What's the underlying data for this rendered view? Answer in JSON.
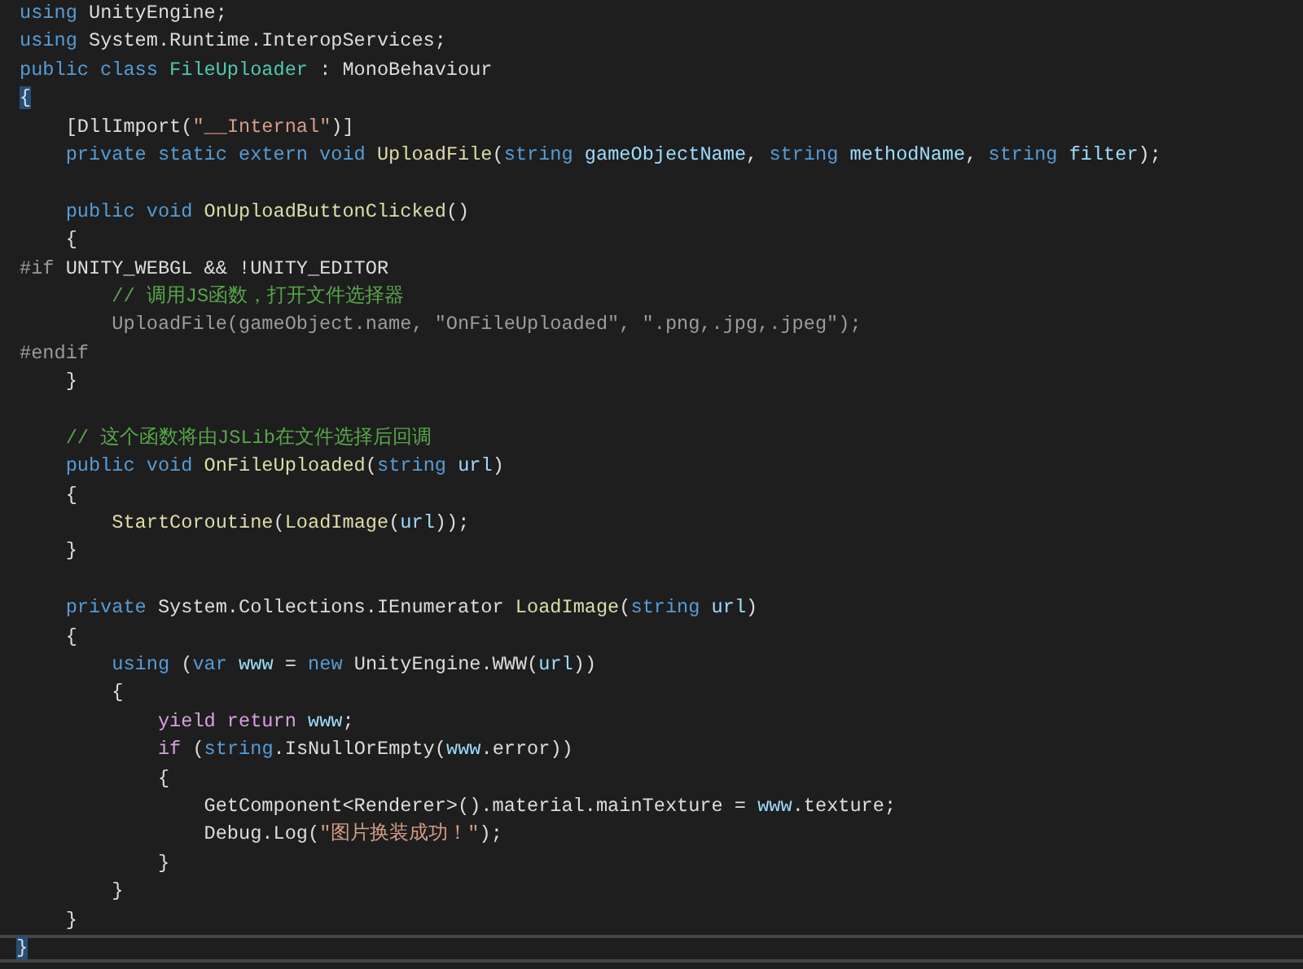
{
  "editor": {
    "lines": [
      {
        "kind": "code",
        "tokens": [
          {
            "text": "using",
            "kind": "keyword"
          },
          {
            "text": " UnityEngine;",
            "kind": "plain"
          }
        ]
      },
      {
        "kind": "code",
        "tokens": [
          {
            "text": "using",
            "kind": "keyword"
          },
          {
            "text": " System.Runtime.InteropServices;",
            "kind": "plain"
          }
        ]
      },
      {
        "kind": "code",
        "tokens": [
          {
            "text": "public class ",
            "kind": "keyword"
          },
          {
            "text": "FileUploader",
            "kind": "type"
          },
          {
            "text": " : MonoBehaviour",
            "kind": "plain"
          }
        ]
      },
      {
        "kind": "code",
        "tokens": [
          {
            "text": "{",
            "kind": "plain",
            "highlighted": true
          }
        ]
      },
      {
        "kind": "code",
        "tokens": [
          {
            "text": "    [DllImport(",
            "kind": "plain"
          },
          {
            "text": "\"__Internal\"",
            "kind": "string"
          },
          {
            "text": ")]",
            "kind": "plain"
          }
        ]
      },
      {
        "kind": "code",
        "tokens": [
          {
            "text": "    private static extern void ",
            "kind": "keyword"
          },
          {
            "text": "UploadFile",
            "kind": "method"
          },
          {
            "text": "(",
            "kind": "plain"
          },
          {
            "text": "string ",
            "kind": "keyword"
          },
          {
            "text": "gameObjectName",
            "kind": "param"
          },
          {
            "text": ", ",
            "kind": "plain"
          },
          {
            "text": "string ",
            "kind": "keyword"
          },
          {
            "text": "methodName",
            "kind": "param"
          },
          {
            "text": ", ",
            "kind": "plain"
          },
          {
            "text": "string ",
            "kind": "keyword"
          },
          {
            "text": "filter",
            "kind": "param"
          },
          {
            "text": ");",
            "kind": "plain"
          }
        ]
      },
      {
        "kind": "blank"
      },
      {
        "kind": "code",
        "tokens": [
          {
            "text": "    public void ",
            "kind": "keyword"
          },
          {
            "text": "OnUploadButtonClicked",
            "kind": "method"
          },
          {
            "text": "()",
            "kind": "plain"
          }
        ]
      },
      {
        "kind": "code",
        "tokens": [
          {
            "text": "    {",
            "kind": "plain"
          }
        ]
      },
      {
        "kind": "code",
        "tokens": [
          {
            "text": "#if",
            "kind": "preprocessor"
          },
          {
            "text": " UNITY_WEBGL && !UNITY_EDITOR",
            "kind": "plain"
          }
        ]
      },
      {
        "kind": "code",
        "tokens": [
          {
            "text": "        // 调用JS函数，打开文件选择器",
            "kind": "comment"
          }
        ]
      },
      {
        "kind": "code",
        "tokens": [
          {
            "text": "        UploadFile(gameObject.name, \"OnFileUploaded\", \".png,.jpg,.jpeg\");",
            "kind": "inactive"
          }
        ]
      },
      {
        "kind": "code",
        "tokens": [
          {
            "text": "#endif",
            "kind": "preprocessor"
          }
        ]
      },
      {
        "kind": "code",
        "tokens": [
          {
            "text": "    }",
            "kind": "plain"
          }
        ]
      },
      {
        "kind": "blank"
      },
      {
        "kind": "code",
        "tokens": [
          {
            "text": "    // 这个函数将由JSLib在文件选择后回调",
            "kind": "comment"
          }
        ]
      },
      {
        "kind": "code",
        "tokens": [
          {
            "text": "    public void ",
            "kind": "keyword"
          },
          {
            "text": "OnFileUploaded",
            "kind": "method"
          },
          {
            "text": "(",
            "kind": "plain"
          },
          {
            "text": "string ",
            "kind": "keyword"
          },
          {
            "text": "url",
            "kind": "param"
          },
          {
            "text": ")",
            "kind": "plain"
          }
        ]
      },
      {
        "kind": "code",
        "tokens": [
          {
            "text": "    {",
            "kind": "plain"
          }
        ]
      },
      {
        "kind": "code",
        "tokens": [
          {
            "text": "        StartCoroutine",
            "kind": "method"
          },
          {
            "text": "(",
            "kind": "plain"
          },
          {
            "text": "LoadImage",
            "kind": "method"
          },
          {
            "text": "(",
            "kind": "plain"
          },
          {
            "text": "url",
            "kind": "param"
          },
          {
            "text": "));",
            "kind": "plain"
          }
        ]
      },
      {
        "kind": "code",
        "tokens": [
          {
            "text": "    }",
            "kind": "plain"
          }
        ]
      },
      {
        "kind": "blank"
      },
      {
        "kind": "code",
        "tokens": [
          {
            "text": "    private",
            "kind": "keyword"
          },
          {
            "text": " System.Collections.IEnumerator ",
            "kind": "plain"
          },
          {
            "text": "LoadImage",
            "kind": "method"
          },
          {
            "text": "(",
            "kind": "plain"
          },
          {
            "text": "string ",
            "kind": "keyword"
          },
          {
            "text": "url",
            "kind": "param"
          },
          {
            "text": ")",
            "kind": "plain"
          }
        ]
      },
      {
        "kind": "code",
        "tokens": [
          {
            "text": "    {",
            "kind": "plain"
          }
        ]
      },
      {
        "kind": "code",
        "tokens": [
          {
            "text": "        using",
            "kind": "keyword"
          },
          {
            "text": " (",
            "kind": "plain"
          },
          {
            "text": "var ",
            "kind": "keyword"
          },
          {
            "text": "www",
            "kind": "param"
          },
          {
            "text": " = ",
            "kind": "plain"
          },
          {
            "text": "new",
            "kind": "keyword"
          },
          {
            "text": " UnityEngine.WWW(",
            "kind": "plain"
          },
          {
            "text": "url",
            "kind": "param"
          },
          {
            "text": "))",
            "kind": "plain"
          }
        ]
      },
      {
        "kind": "code",
        "tokens": [
          {
            "text": "        {",
            "kind": "plain"
          }
        ]
      },
      {
        "kind": "code",
        "tokens": [
          {
            "text": "            yield return ",
            "kind": "control"
          },
          {
            "text": "www",
            "kind": "param"
          },
          {
            "text": ";",
            "kind": "plain"
          }
        ]
      },
      {
        "kind": "code",
        "tokens": [
          {
            "text": "            if",
            "kind": "control"
          },
          {
            "text": " (",
            "kind": "plain"
          },
          {
            "text": "string",
            "kind": "keyword"
          },
          {
            "text": ".IsNullOrEmpty(",
            "kind": "plain"
          },
          {
            "text": "www",
            "kind": "param"
          },
          {
            "text": ".error))",
            "kind": "plain"
          }
        ]
      },
      {
        "kind": "code",
        "tokens": [
          {
            "text": "            {",
            "kind": "plain"
          }
        ]
      },
      {
        "kind": "code",
        "tokens": [
          {
            "text": "                GetComponent<Renderer>().material.mainTexture = ",
            "kind": "plain"
          },
          {
            "text": "www",
            "kind": "param"
          },
          {
            "text": ".texture;",
            "kind": "plain"
          }
        ]
      },
      {
        "kind": "code",
        "tokens": [
          {
            "text": "                Debug.Log(",
            "kind": "plain"
          },
          {
            "text": "\"图片换装成功！\"",
            "kind": "string"
          },
          {
            "text": ");",
            "kind": "plain"
          }
        ]
      },
      {
        "kind": "code",
        "tokens": [
          {
            "text": "            }",
            "kind": "plain"
          }
        ]
      },
      {
        "kind": "code",
        "tokens": [
          {
            "text": "        }",
            "kind": "plain"
          }
        ]
      },
      {
        "kind": "code",
        "tokens": [
          {
            "text": "    }",
            "kind": "plain"
          }
        ]
      },
      {
        "kind": "code",
        "current": true,
        "tokens": [
          {
            "text": "}",
            "kind": "plain",
            "highlighted": true
          }
        ]
      }
    ]
  }
}
